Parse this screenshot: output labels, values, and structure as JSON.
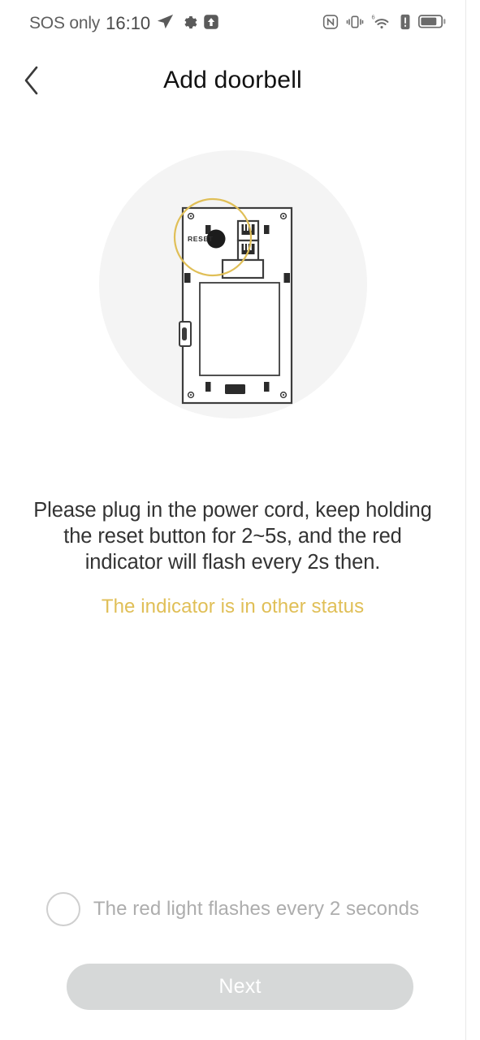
{
  "statusbar": {
    "carrier": "SOS only",
    "clock": "16:10",
    "left_icons": [
      "navigation-send-icon",
      "gear-icon",
      "upload-arrow-icon"
    ],
    "right_icons": [
      "nfc-icon",
      "vibrate-icon",
      "wifi-6-icon",
      "alert-icon",
      "battery-icon"
    ],
    "wifi_generation": "6"
  },
  "header": {
    "back_label": "‹",
    "title": "Add doorbell"
  },
  "illustration": {
    "name": "doorbell-back-panel-diagram",
    "reset_label": "RESET",
    "highlight_color": "#e0bf57",
    "circle_bg_color": "#f4f4f4",
    "line_color": "#3d3d3d"
  },
  "main": {
    "instruction": "Please plug in the power cord, keep holding the reset button for 2~5s, and the red indicator will flash every 2s then.",
    "other_status_link": "The indicator is in other status",
    "confirm_label": "The red light flashes every 2 seconds",
    "confirm_checked": false
  },
  "footer": {
    "next_label": "Next",
    "next_enabled": false
  },
  "colors": {
    "accent": "#e0bf57",
    "title": "#111111",
    "body_text": "#333333",
    "muted_text": "#adadad",
    "button_disabled_bg": "#d6d8d8"
  }
}
